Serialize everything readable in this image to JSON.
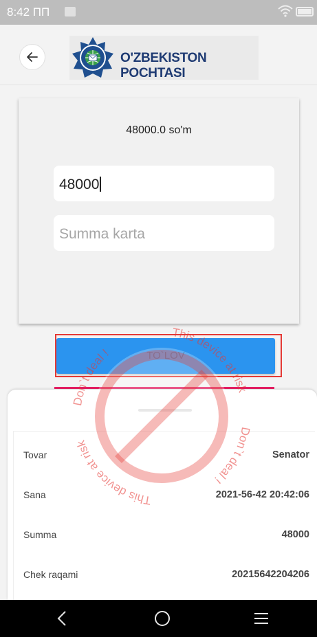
{
  "status_bar": {
    "time": "8:42 ПП"
  },
  "app_bar": {
    "logo_text": "O'ZBEKISTON POCHTASI"
  },
  "payment": {
    "amount_display": "48000.0 so'm",
    "amount_input_value": "48000",
    "card_placeholder": "Summa karta",
    "pay_button_label": "TO`LOV"
  },
  "receipt": {
    "rows": [
      {
        "label": "Tovar",
        "value": "Senator"
      },
      {
        "label": "Sana",
        "value": "2021-56-42 20:42:06"
      },
      {
        "label": "Summa",
        "value": "48000"
      },
      {
        "label": "Chek raqami",
        "value": "20215642204206"
      }
    ]
  },
  "watermark": {
    "text_top": "This device at risk",
    "text_right": "Don`t deal !",
    "text_bottom": "This device at risk",
    "text_left": "Don`t deal !",
    "color": "#e53935"
  },
  "colors": {
    "accent": "#2b94ef",
    "highlight": "#e53935",
    "pink_line": "#e91e63"
  }
}
